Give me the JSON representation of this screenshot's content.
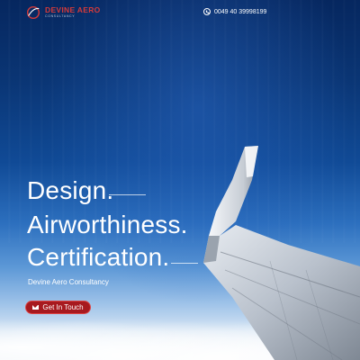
{
  "brand": {
    "name": "DEVINE AERO",
    "tagline": "CONSULTANCY"
  },
  "contact": {
    "phone": "0049 40 39998199",
    "icon": "phone-icon"
  },
  "hero": {
    "line1": "Design.",
    "line2": "Airworthiness.",
    "line3": "Certification.",
    "subtitle": "Devine Aero Consultancy",
    "cta_label": "Get In Touch",
    "cta_icon": "mail-icon"
  },
  "colors": {
    "accent": "#a7191f",
    "brand_red": "#d43a3a",
    "sky_dark": "#0a3574"
  }
}
